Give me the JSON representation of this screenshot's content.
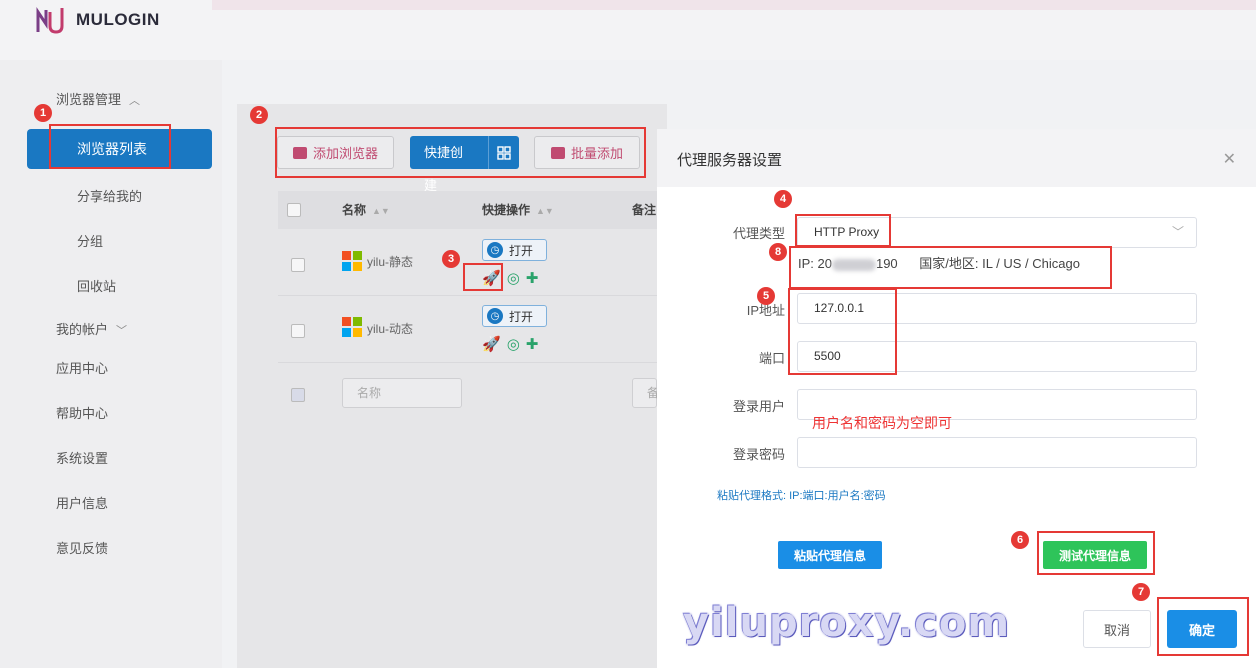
{
  "app": {
    "logo_text": "MULOGIN"
  },
  "sidebar": {
    "browser_mgmt": "浏览器管理",
    "items": [
      "浏览器列表",
      "分享给我的",
      "分组",
      "回收站"
    ],
    "my_account": "我的帐户",
    "menu": [
      "应用中心",
      "帮助中心",
      "系统设置",
      "用户信息",
      "意见反馈"
    ]
  },
  "toolbar": {
    "add_browser": "添加浏览器",
    "quick_create": "快捷创建",
    "batch_add": "批量添加"
  },
  "table": {
    "headers": {
      "name": "名称",
      "quick_ops": "快捷操作",
      "note": "备注"
    },
    "rows": [
      {
        "name": "yilu-静态",
        "open": "打开"
      },
      {
        "name": "yilu-动态",
        "open": "打开"
      }
    ],
    "filter_name_placeholder": "名称",
    "filter_note_placeholder": "备"
  },
  "dialog": {
    "title": "代理服务器设置",
    "proxy_type_label": "代理类型",
    "proxy_type_value": "HTTP Proxy",
    "ip_prefix": "IP: 20",
    "ip_suffix": "190",
    "region": "国家/地区: IL / US / Chicago",
    "ip_label": "IP地址",
    "ip_value": "127.0.0.1",
    "port_label": "端口",
    "port_value": "5500",
    "user_label": "登录用户",
    "pass_label": "登录密码",
    "note": "用户名和密码为空即可",
    "paste_hint": "粘贴代理格式: IP:端口:用户名:密码",
    "paste_button": "粘贴代理信息",
    "test_button": "测试代理信息",
    "cancel": "取消",
    "confirm": "确定"
  },
  "annotations": [
    "1",
    "2",
    "3",
    "4",
    "5",
    "6",
    "7",
    "8"
  ],
  "watermark": "yiluproxy.com"
}
